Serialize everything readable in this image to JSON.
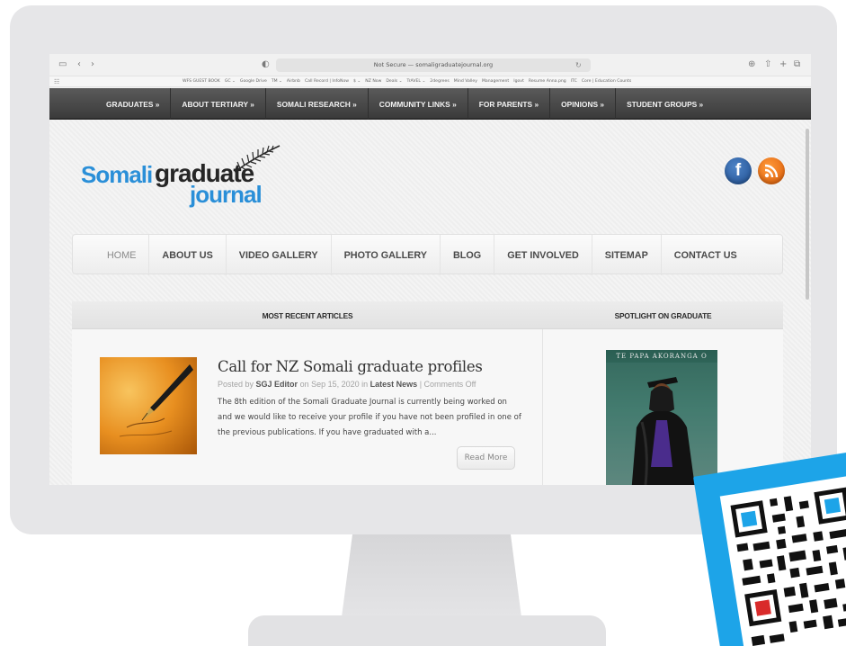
{
  "browser": {
    "address": "Not Secure — somaligraduatejournal.org",
    "bookmarks": [
      "WFS GUEST BOOK",
      "GC ⌄",
      "Google Drive",
      "TM ⌄",
      "Airbnb",
      "Call Record | InfoNow",
      "$ ⌄",
      "NZ Now",
      "Deals ⌄",
      "TrAVEL ⌄",
      "2degrees",
      "Mind Valley",
      "Management",
      "Igovt",
      "Resume Anna.png",
      "ITC",
      "Core | Education Counts"
    ]
  },
  "topnav": {
    "items": [
      "GRADUATES »",
      "ABOUT TERTIARY »",
      "SOMALI RESEARCH »",
      "COMMUNITY LINKS »",
      "FOR PARENTS »",
      "OPINIONS »",
      "STUDENT GROUPS »"
    ]
  },
  "logo": {
    "part1": "Somali",
    "part2": "graduate",
    "part3": "journal"
  },
  "social": {
    "facebook_letter": "f"
  },
  "mainnav": {
    "items": [
      "HOME",
      "ABOUT US",
      "VIDEO GALLERY",
      "PHOTO GALLERY",
      "BLOG",
      "GET INVOLVED",
      "SITEMAP",
      "CONTACT US"
    ]
  },
  "sections": {
    "recent": "MOST RECENT ARTICLES",
    "spotlight": "SPOTLIGHT ON GRADUATE"
  },
  "article": {
    "title": "Call for NZ Somali graduate profiles",
    "posted_by": "Posted by",
    "author": "SGJ Editor",
    "on": "on Sep 15, 2020 in",
    "category": "Latest News",
    "comments": "| Comments Off",
    "excerpt": "The 8th edition of the Somali Graduate Journal is currently being worked on and we would like to receive your profile if you have not been profiled in one of the previous publications. If you have graduated with a...",
    "read_more": "Read More"
  },
  "spotlight": {
    "caption": "TE PAPA AKORANGA O"
  },
  "colors": {
    "brand_blue": "#2a8fd8",
    "nav_dark": "#4a4a4a",
    "qr_blue": "#1da4e8",
    "qr_red": "#d92b2b"
  }
}
